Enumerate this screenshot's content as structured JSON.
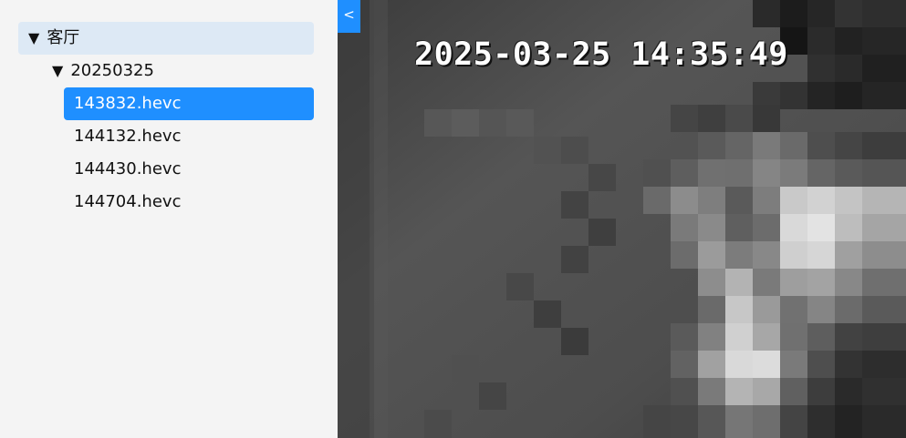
{
  "sidebar": {
    "root": {
      "arrow": "▼",
      "label": "客厅"
    },
    "folder": {
      "arrow": "▼",
      "label": "20250325"
    },
    "files": [
      {
        "label": "143832.hevc",
        "selected": true
      },
      {
        "label": "144132.hevc",
        "selected": false
      },
      {
        "label": "144430.hevc",
        "selected": false
      },
      {
        "label": "144704.hevc",
        "selected": false
      }
    ]
  },
  "video": {
    "collapse_label": "<",
    "timestamp": "2025-03-25 14:35:49"
  },
  "colors": {
    "sidebar_bg": "#f4f4f4",
    "root_highlight": "#dde9f5",
    "accent": "#1f8fff",
    "video_base": "#4a4a4a"
  }
}
